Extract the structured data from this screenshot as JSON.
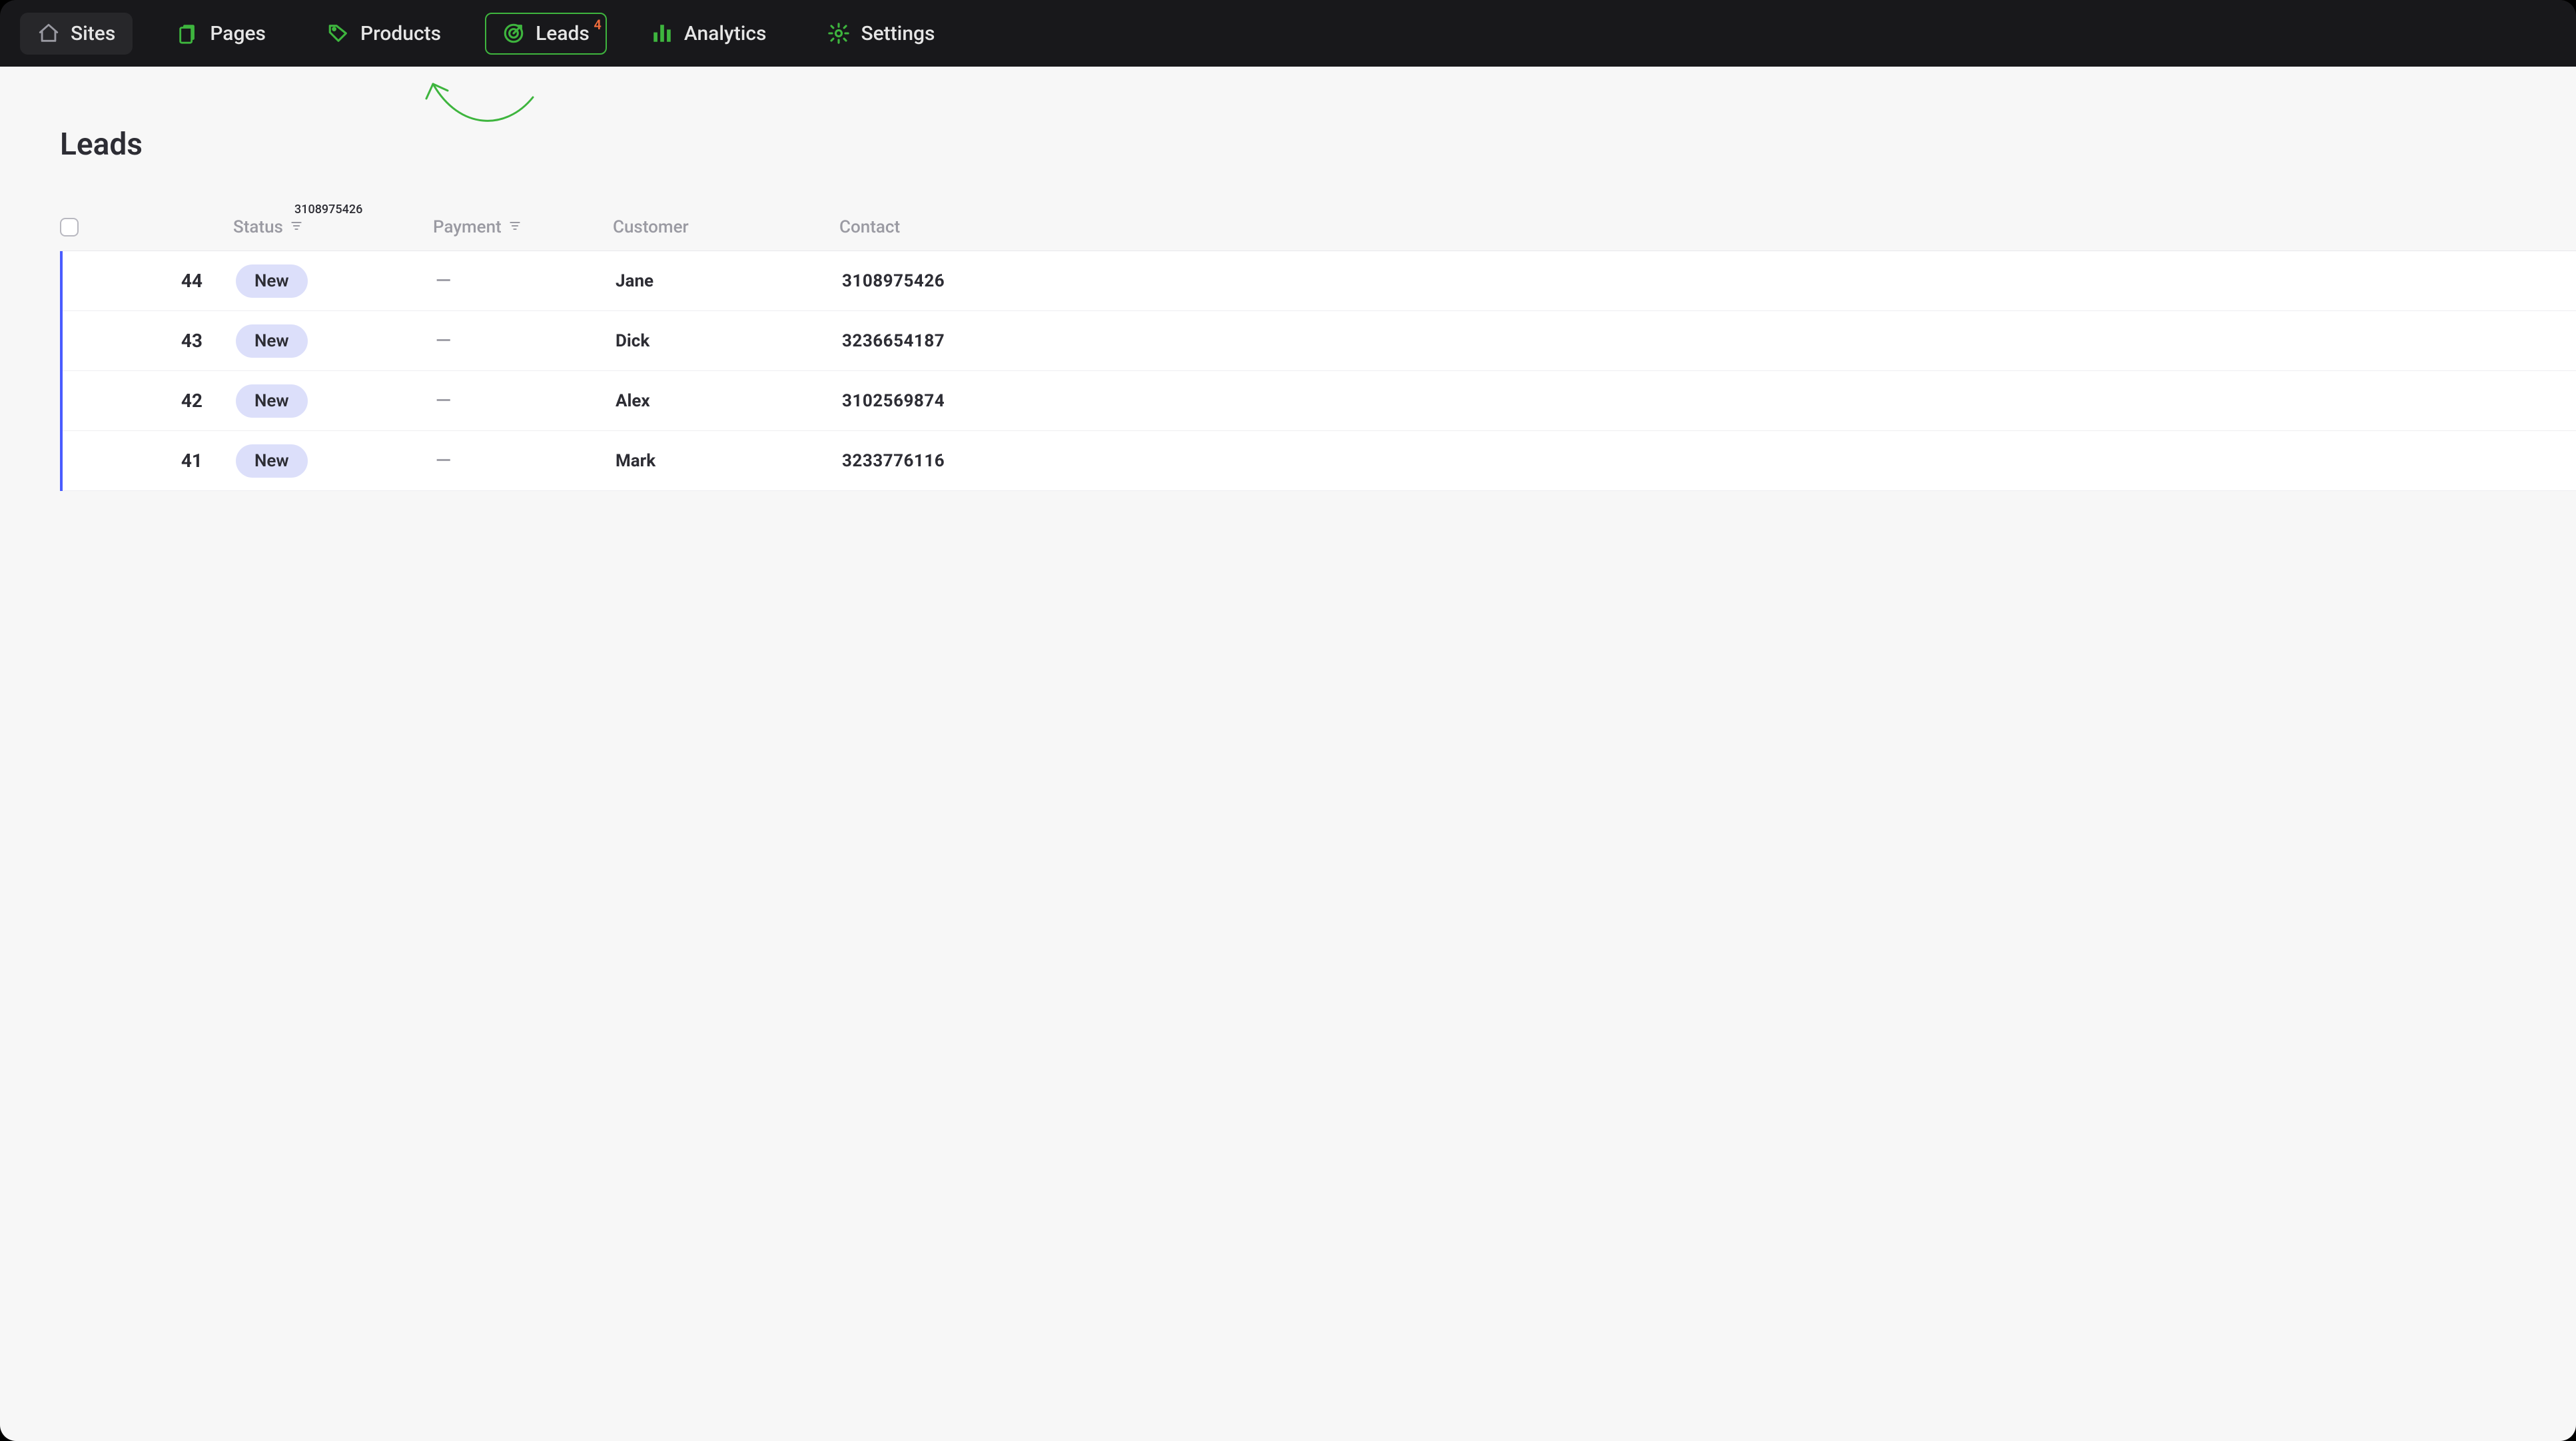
{
  "nav": {
    "sites": {
      "label": "Sites"
    },
    "pages": {
      "label": "Pages"
    },
    "products": {
      "label": "Products"
    },
    "leads": {
      "label": "Leads",
      "badge": "4"
    },
    "analytics": {
      "label": "Analytics"
    },
    "settings": {
      "label": "Settings"
    }
  },
  "page": {
    "title": "Leads"
  },
  "table": {
    "headers": {
      "status": "Status",
      "payment": "Payment",
      "customer": "Customer",
      "contact": "Contact"
    },
    "tooltip": "3108975426",
    "rows": [
      {
        "id": "44",
        "status": "New",
        "payment": "—",
        "customer": "Jane",
        "contact": "3108975426"
      },
      {
        "id": "43",
        "status": "New",
        "payment": "—",
        "customer": "Dick",
        "contact": "3236654187"
      },
      {
        "id": "42",
        "status": "New",
        "payment": "—",
        "customer": "Alex",
        "contact": "3102569874"
      },
      {
        "id": "41",
        "status": "New",
        "payment": "—",
        "customer": "Mark",
        "contact": "3233776116"
      }
    ]
  }
}
